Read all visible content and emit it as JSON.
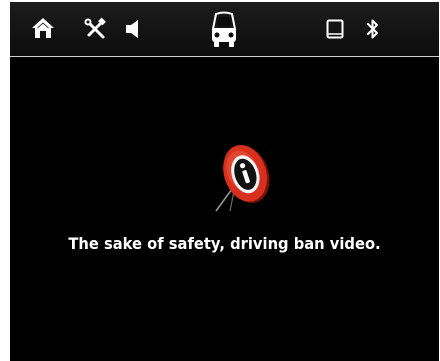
{
  "topbar": {
    "icons": [
      {
        "name": "home-icon"
      },
      {
        "name": "tools-icon"
      },
      {
        "name": "volume-icon"
      },
      {
        "name": "car-icon"
      },
      {
        "name": "tablet-icon"
      },
      {
        "name": "bluetooth-icon"
      }
    ]
  },
  "warning": {
    "icon": "info-warning-sign-icon",
    "message": "The sake of safety, driving ban video."
  },
  "colors": {
    "background": "#000000",
    "sign_red": "#d8301e",
    "text": "#ffffff"
  }
}
